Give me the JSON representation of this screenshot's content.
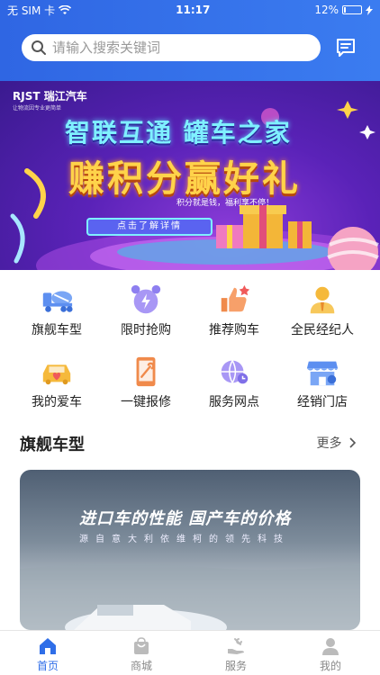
{
  "status_bar": {
    "carrier": "无 SIM 卡",
    "time": "11:17",
    "battery": "12%",
    "battery_level": 0.12
  },
  "search": {
    "placeholder": "请输入搜索关键词"
  },
  "banner": {
    "brand": "RJST 瑞江汽车",
    "brand_sub": "让物流因专业更简单",
    "headline1": "智联互通 罐车之家",
    "headline2": "赚积分赢好礼",
    "subtext": "积分就是钱，福利享不停！",
    "button": "点击了解详情",
    "slides": 3,
    "active_slide": 1
  },
  "grid": [
    {
      "label": "旗舰车型",
      "icon": "mixer-truck-icon"
    },
    {
      "label": "限时抢购",
      "icon": "alarm-clock-icon"
    },
    {
      "label": "推荐购车",
      "icon": "thumbs-up-icon"
    },
    {
      "label": "全民经纪人",
      "icon": "agent-person-icon"
    },
    {
      "label": "我的爱车",
      "icon": "my-car-icon"
    },
    {
      "label": "一键报修",
      "icon": "repair-phone-icon"
    },
    {
      "label": "服务网点",
      "icon": "service-globe-icon"
    },
    {
      "label": "经销门店",
      "icon": "store-icon"
    }
  ],
  "section": {
    "title": "旗舰车型",
    "more": "更多",
    "card_title": "进口车的性能 国产车的价格",
    "card_subtitle": "源自意大利依维柯的领先科技"
  },
  "tabbar": [
    {
      "label": "首页",
      "icon": "home-icon",
      "active": true
    },
    {
      "label": "商城",
      "icon": "shop-bag-icon",
      "active": false
    },
    {
      "label": "服务",
      "icon": "service-hand-icon",
      "active": false
    },
    {
      "label": "我的",
      "icon": "profile-icon",
      "active": false
    }
  ],
  "colors": {
    "header": "#2f66e3",
    "accent": "#2f6ee8",
    "icon_blue": "#5d8ff0",
    "icon_purple": "#8e7ff0",
    "icon_orange": "#f08a4b",
    "icon_yellow": "#f5b93b"
  }
}
